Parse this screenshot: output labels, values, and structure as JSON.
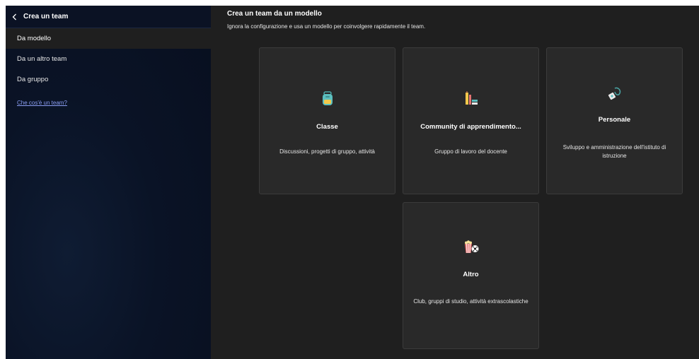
{
  "sidebar": {
    "title": "Crea un team",
    "back_icon": "chevron-left-icon",
    "items": [
      {
        "label": "Da modello",
        "active": true
      },
      {
        "label": "Da un altro team",
        "active": false
      },
      {
        "label": "Da gruppo",
        "active": false
      }
    ],
    "help_link": "Che cos'è un team?"
  },
  "main": {
    "title": "Crea un team da un modello",
    "subtitle": "Ignora la configurazione e usa un modello per coinvolgere rapidamente il team.",
    "cards": [
      {
        "title": "Classe",
        "description": "Discussioni, progetti di gruppo, attività",
        "icon": "backpack-icon"
      },
      {
        "title": "Community di apprendimento...",
        "description": "Gruppo di lavoro del docente",
        "icon": "books-pencil-icon"
      },
      {
        "title": "Personale",
        "description": "Sviluppo e amministrazione dell'istituto di istruzione",
        "icon": "badge-lanyard-icon"
      },
      {
        "title": "Altro",
        "description": "Club, gruppi di studio, attività extrascolastiche",
        "icon": "popcorn-soccer-icon"
      }
    ]
  },
  "colors": {
    "sidebar_bg": "#0a1326",
    "main_bg": "#1f1f1f",
    "card_bg": "#292929",
    "link": "#8a9df2"
  }
}
